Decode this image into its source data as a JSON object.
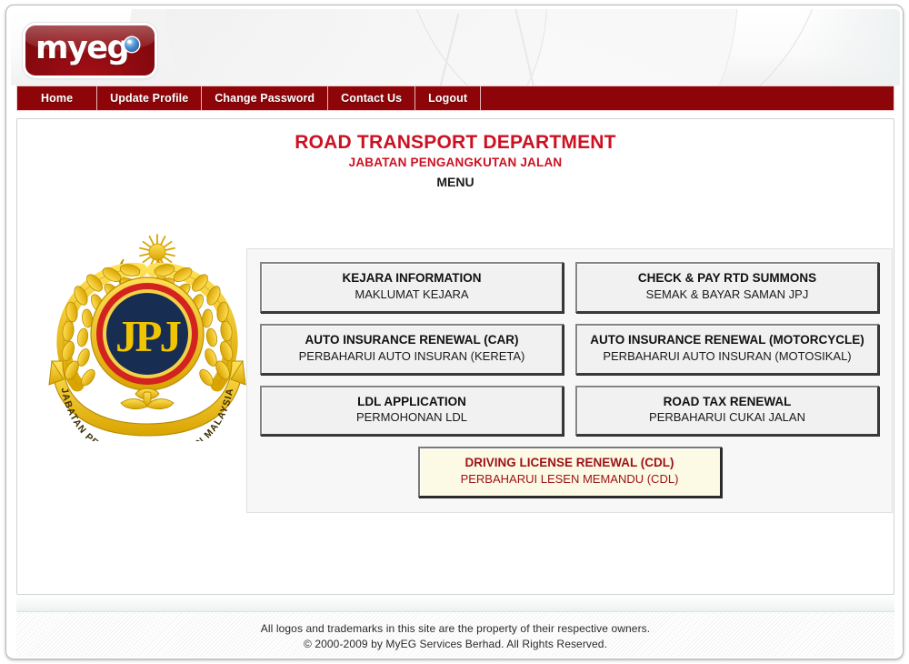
{
  "brand": {
    "logo_text": "myeg",
    "logo_icon": "eye-icon"
  },
  "nav": {
    "items": [
      {
        "label": "Home",
        "name": "nav-home"
      },
      {
        "label": "Update Profile",
        "name": "nav-update-profile"
      },
      {
        "label": "Change Password",
        "name": "nav-change-password"
      },
      {
        "label": "Contact Us",
        "name": "nav-contact-us"
      },
      {
        "label": "Logout",
        "name": "nav-logout"
      }
    ]
  },
  "page": {
    "title_en": "ROAD TRANSPORT DEPARTMENT",
    "title_ms": "JABATAN PENGANGKUTAN JALAN",
    "section_label": "MENU"
  },
  "crest": {
    "name": "jpj-crest-logo",
    "monogram": "JPJ",
    "banner_text": "JABATAN PENGANGKUTAN JALAN MALAYSIA",
    "colors": {
      "gold": "#f0c000",
      "gold_dark": "#c99a00",
      "navy": "#172d52",
      "red_ring": "#d2231f"
    }
  },
  "menu": {
    "rows": [
      [
        {
          "name": "kejara-information",
          "label_en": "KEJARA INFORMATION",
          "label_ms": "MAKLUMAT KEJARA",
          "highlight": false
        },
        {
          "name": "check-pay-rtd-summons",
          "label_en": "CHECK & PAY RTD SUMMONS",
          "label_ms": "SEMAK & BAYAR SAMAN JPJ",
          "highlight": false
        }
      ],
      [
        {
          "name": "auto-insurance-renewal-car",
          "label_en": "AUTO INSURANCE RENEWAL (CAR)",
          "label_ms": "PERBAHARUI AUTO INSURAN (KERETA)",
          "highlight": false
        },
        {
          "name": "auto-insurance-renewal-motorcycle",
          "label_en": "AUTO INSURANCE RENEWAL (MOTORCYCLE)",
          "label_ms": "PERBAHARUI AUTO INSURAN (MOTOSIKAL)",
          "highlight": false
        }
      ],
      [
        {
          "name": "ldl-application",
          "label_en": "LDL APPLICATION",
          "label_ms": "PERMOHONAN LDL",
          "highlight": false
        },
        {
          "name": "road-tax-renewal",
          "label_en": "ROAD TAX RENEWAL",
          "label_ms": "PERBAHARUI CUKAI JALAN",
          "highlight": false
        }
      ],
      [
        {
          "name": "driving-license-renewal-cdl",
          "label_en": "DRIVING LICENSE RENEWAL (CDL)",
          "label_ms": "PERBAHARUI LESEN MEMANDU (CDL)",
          "highlight": true
        }
      ]
    ]
  },
  "footer": {
    "line1": "All logos and trademarks in this site are the property of their respective owners.",
    "line2": "© 2000-2009 by MyEG Services Berhad. All Rights Reserved."
  },
  "theme": {
    "nav_bg": "#8d0508",
    "title_red": "#cc1122",
    "highlight_bg": "#fcfae4",
    "highlight_text": "#9d1117"
  }
}
